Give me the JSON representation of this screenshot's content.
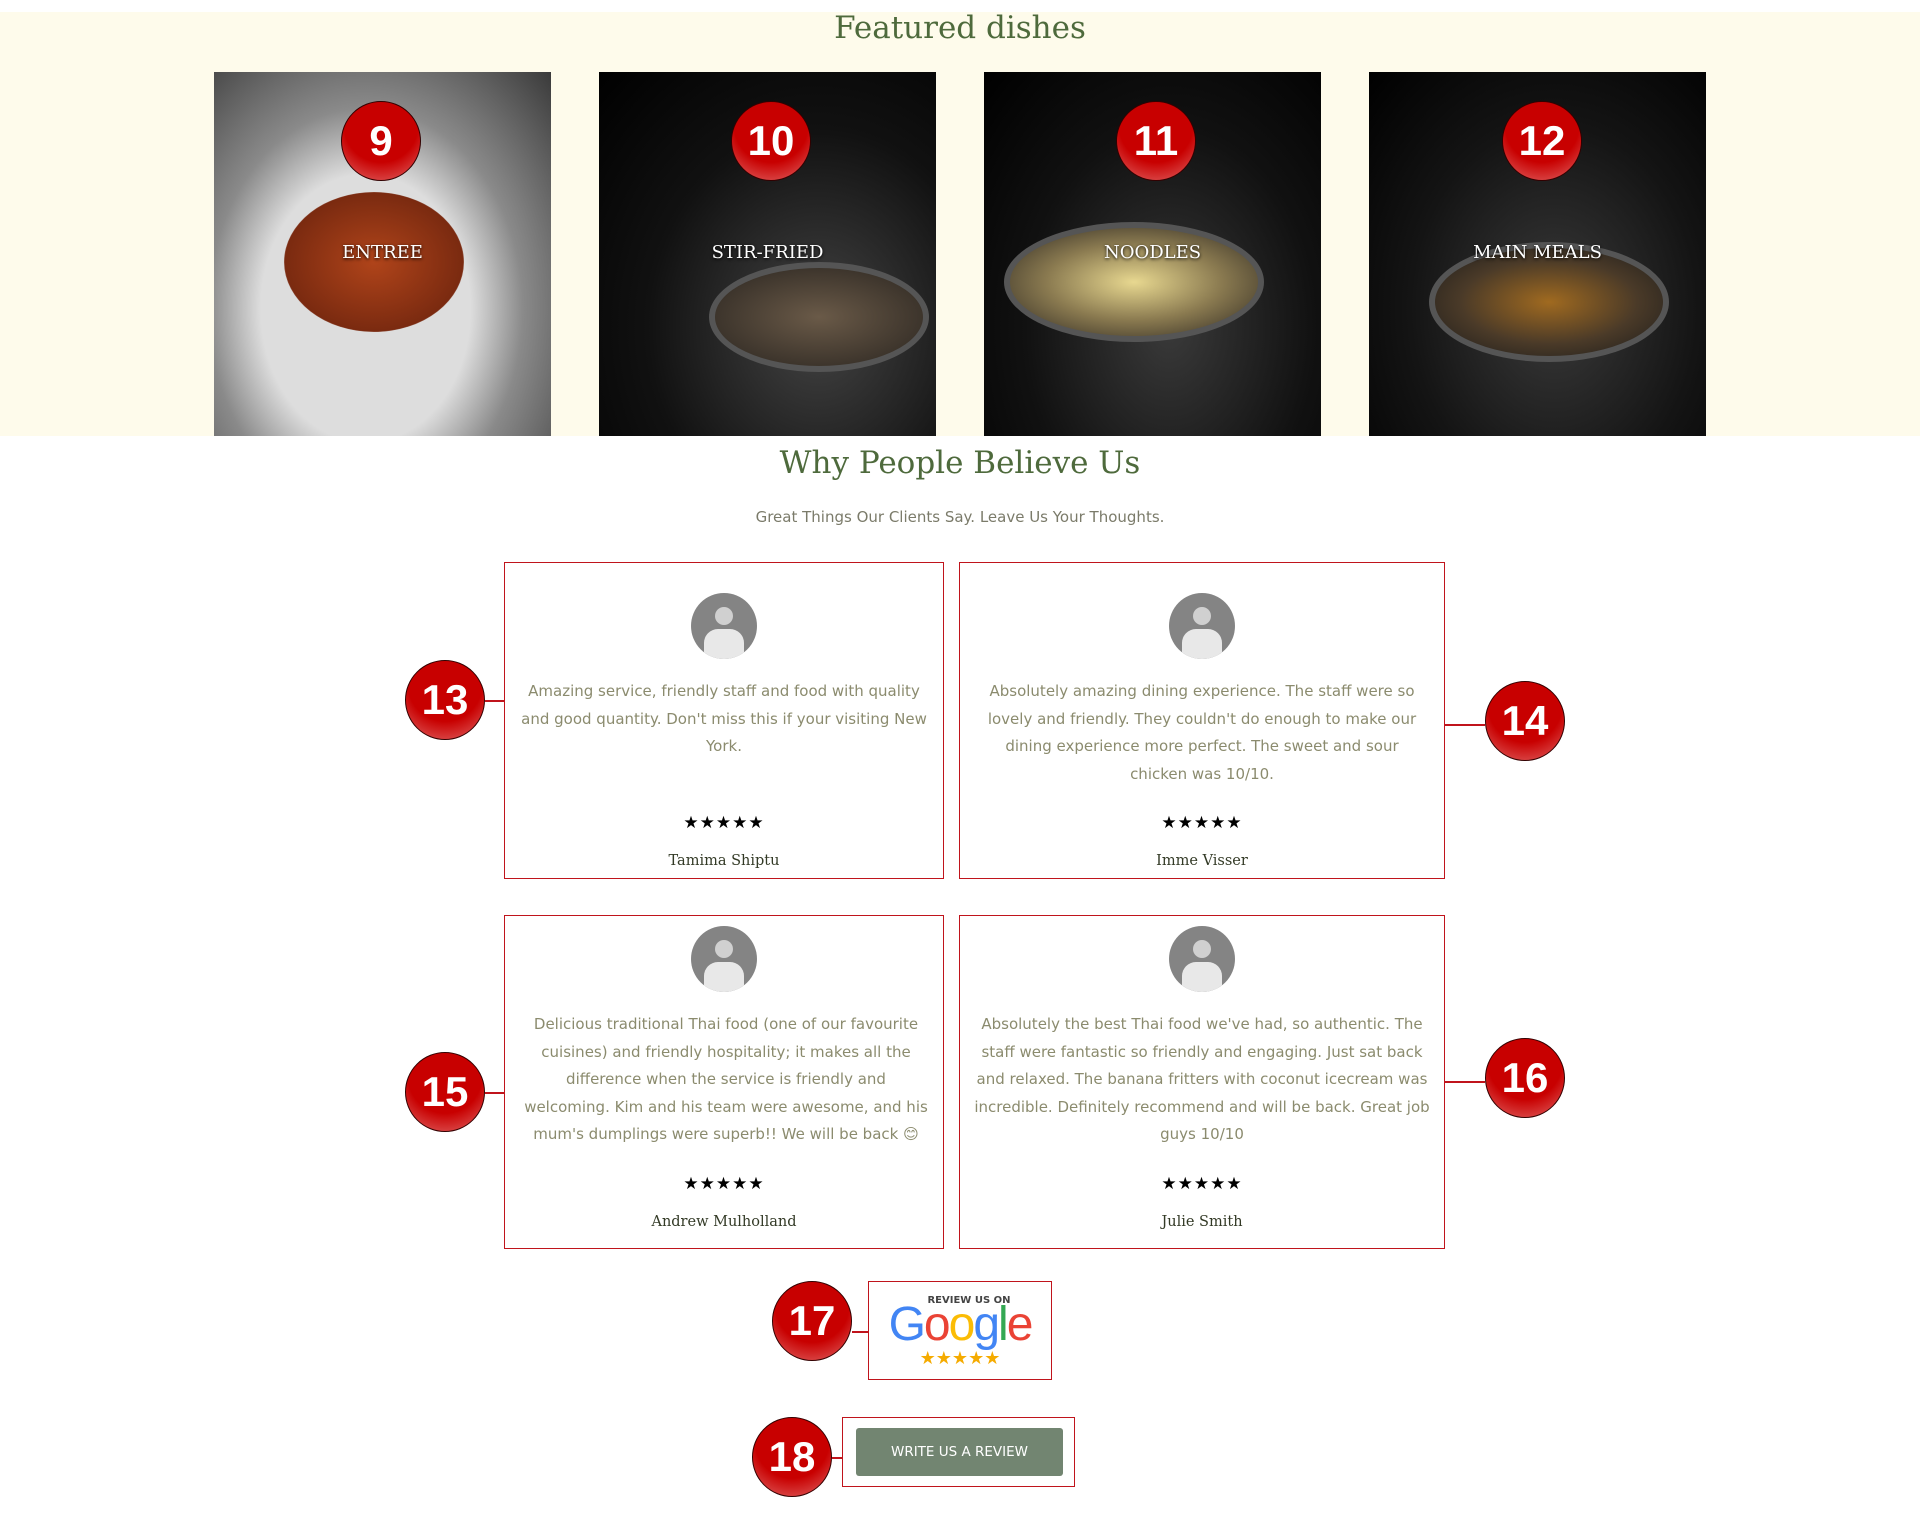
{
  "featured": {
    "title": "Featured dishes",
    "dishes": [
      {
        "label": "ENTREE",
        "badge": "9"
      },
      {
        "label": "STIR-FRIED",
        "badge": "10"
      },
      {
        "label": "NOODLES",
        "badge": "11"
      },
      {
        "label": "MAIN MEALS",
        "badge": "12"
      }
    ]
  },
  "testimonials": {
    "title": "Why People Believe Us",
    "subtitle": "Great Things Our Clients Say. Leave Us Your Thoughts.",
    "reviews": [
      {
        "badge": "13",
        "text": "Amazing service, friendly staff and food with quality and good quantity. Don't miss this if your visiting New York.",
        "stars": "★★★★★",
        "name": "Tamima Shiptu"
      },
      {
        "badge": "14",
        "text": "Absolutely amazing dining experience. The staff were so lovely and friendly. They couldn't do enough to make our dining experience more perfect. The sweet and sour chicken was 10/10.",
        "stars": "★★★★★",
        "name": "Imme Visser"
      },
      {
        "badge": "15",
        "text": "Delicious traditional Thai food (one of our favourite cuisines) and friendly hospitality; it makes all the difference when the service is friendly and welcoming. Kim and his team were awesome, and his mum's dumplings were superb!! We will be back 😊",
        "stars": "★★★★★",
        "name": "Andrew Mulholland"
      },
      {
        "badge": "16",
        "text": "Absolutely the best Thai food we've had, so authentic. The staff were fantastic so friendly and engaging. Just sat back and relaxed. The banana fritters with coconut icecream was incredible. Definitely recommend and will be back. Great job guys 10/10",
        "stars": "★★★★★",
        "name": "Julie Smith"
      }
    ]
  },
  "google": {
    "badge": "17",
    "small": "REVIEW US ON",
    "logo": "Google",
    "stars": "★★★★★"
  },
  "write_review": {
    "badge": "18",
    "label": "WRITE US A REVIEW"
  },
  "colors": {
    "accent": "#c0141c",
    "heading": "#4e6a3c",
    "button": "#728571",
    "cream": "#fefbeb"
  }
}
